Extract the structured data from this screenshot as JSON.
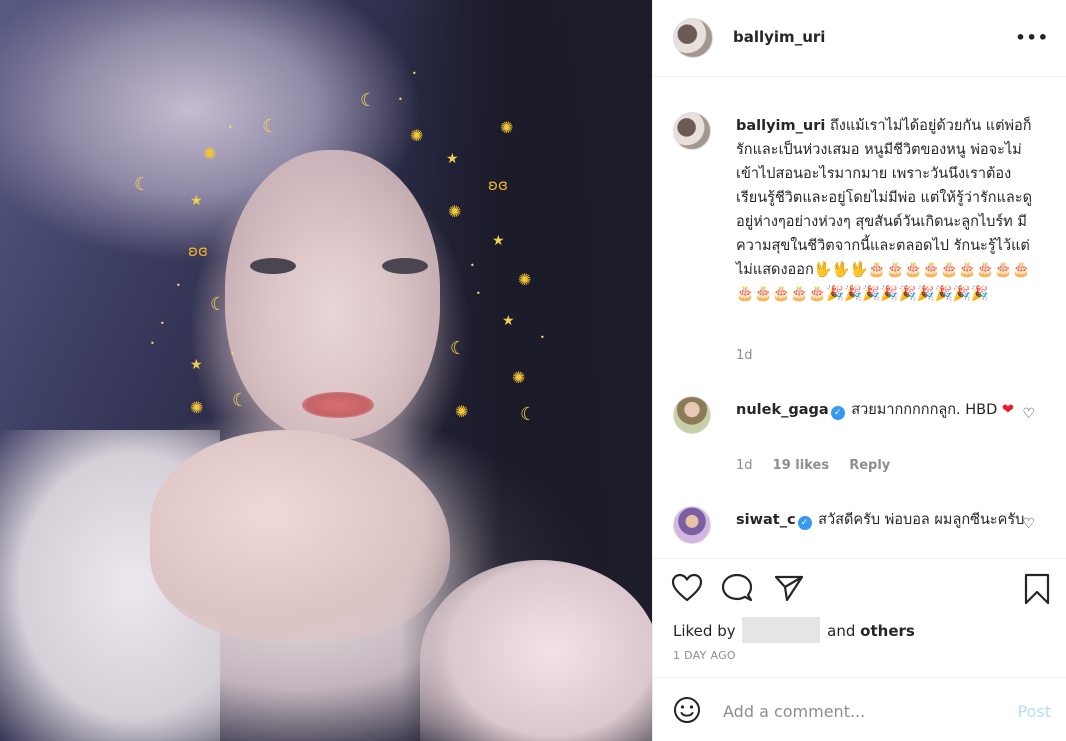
{
  "post": {
    "username": "ballyim_uri",
    "more_icon": "more-options-icon"
  },
  "caption": {
    "username": "ballyim_uri",
    "text": "ถึงแม้เราไม่ได้อยู่ด้วยกัน แต่พ่อก็รักและเป็นห่วงเสมอ หนูมีชีวิตของหนู พ่อจะไม่เข้าไปสอนอะไรมากมาย เพราะวันนึงเราต้องเรียนรู้ชีวิตและอยู่โดยไม่มีพ่อ แต่ให้รู้ว่ารักและดูอยู่ห่างๆอย่างห่วงๆ สุขสันต์วันเกิดนะลูกไบร์ท มีความสุขในชีวิตจากนี้และตลอดไป รักนะรู้ไว้แต่ไม่แสดงออก🖖🖖🖖🎂🎂🎂🎂🎂🎂🎂🎂🎂🎂🎂🎂🎂🎂🎉🎉🎉🎉🎉🎉🎉🎉🎉",
    "time": "1d"
  },
  "comments": [
    {
      "username": "nulek_gaga",
      "verified": true,
      "text": "สวยมากกกกกลูก. HBD",
      "emoji": "❤",
      "time": "1d",
      "likes": "19 likes",
      "reply": "Reply"
    },
    {
      "username": "siwat_c",
      "verified": true,
      "text": "สวัสดีครับ พ่อบอล ผมลูกซีนะครับ"
    }
  ],
  "actions": {
    "liked_by_prefix": "Liked by",
    "liked_by_suffix_and": "and",
    "liked_by_others": "others",
    "date": "1 DAY AGO"
  },
  "composer": {
    "placeholder": "Add a comment...",
    "post_label": "Post"
  },
  "icons": {
    "heart": "heart-icon",
    "comment": "comment-icon",
    "share": "share-icon",
    "bookmark": "bookmark-icon",
    "emoji": "emoji-icon",
    "verified": "verified-badge-icon"
  }
}
